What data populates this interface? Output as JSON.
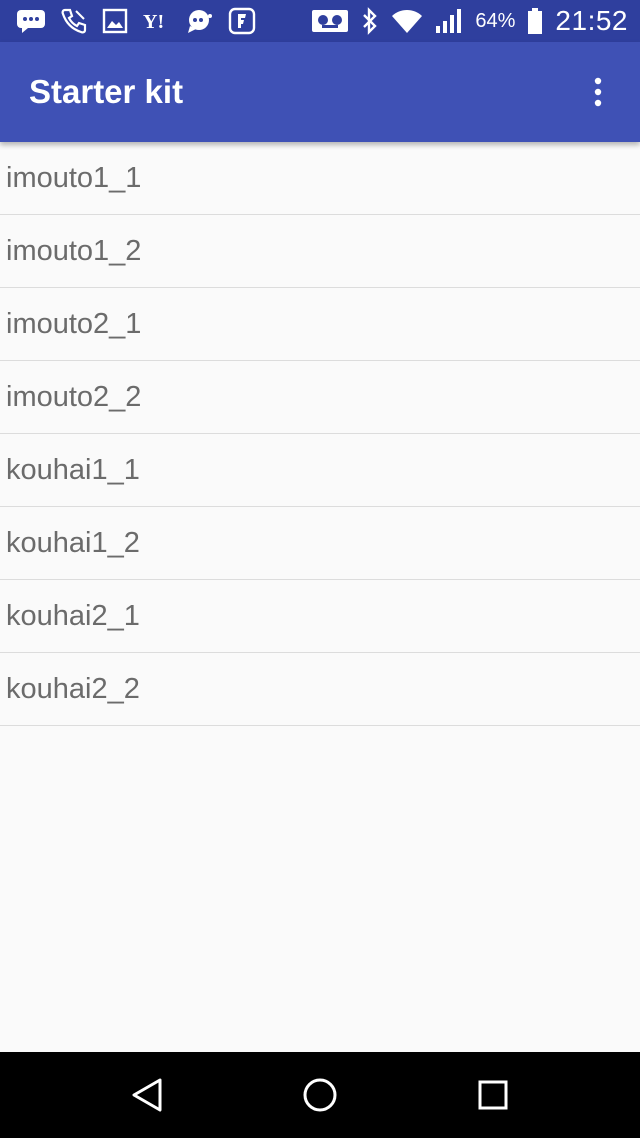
{
  "status_bar": {
    "notification_icons": [
      "message-icon",
      "phone-icon",
      "image-icon",
      "yahoo-icon",
      "chat-icon",
      "foursquare-icon"
    ],
    "yahoo_label": "Y!",
    "system_icons": [
      "voicemail-icon",
      "bluetooth-icon",
      "wifi-icon",
      "signal-icon",
      "battery-icon"
    ],
    "battery_percent": "64%",
    "time": "21:52"
  },
  "app_bar": {
    "title": "Starter kit",
    "overflow_icon": "more-vert-icon"
  },
  "list": {
    "items": [
      {
        "label": "imouto1_1"
      },
      {
        "label": "imouto1_2"
      },
      {
        "label": "imouto2_1"
      },
      {
        "label": "imouto2_2"
      },
      {
        "label": "kouhai1_1"
      },
      {
        "label": "kouhai1_2"
      },
      {
        "label": "kouhai2_1"
      },
      {
        "label": "kouhai2_2"
      }
    ]
  },
  "nav_bar": {
    "buttons": [
      "back-icon",
      "home-icon",
      "recents-icon"
    ]
  },
  "colors": {
    "status_bar": "#2f3f9e",
    "app_bar": "#3f51b5",
    "background": "#fafafa",
    "list_text": "#6b6b6b",
    "divider": "#dcdcdc"
  }
}
